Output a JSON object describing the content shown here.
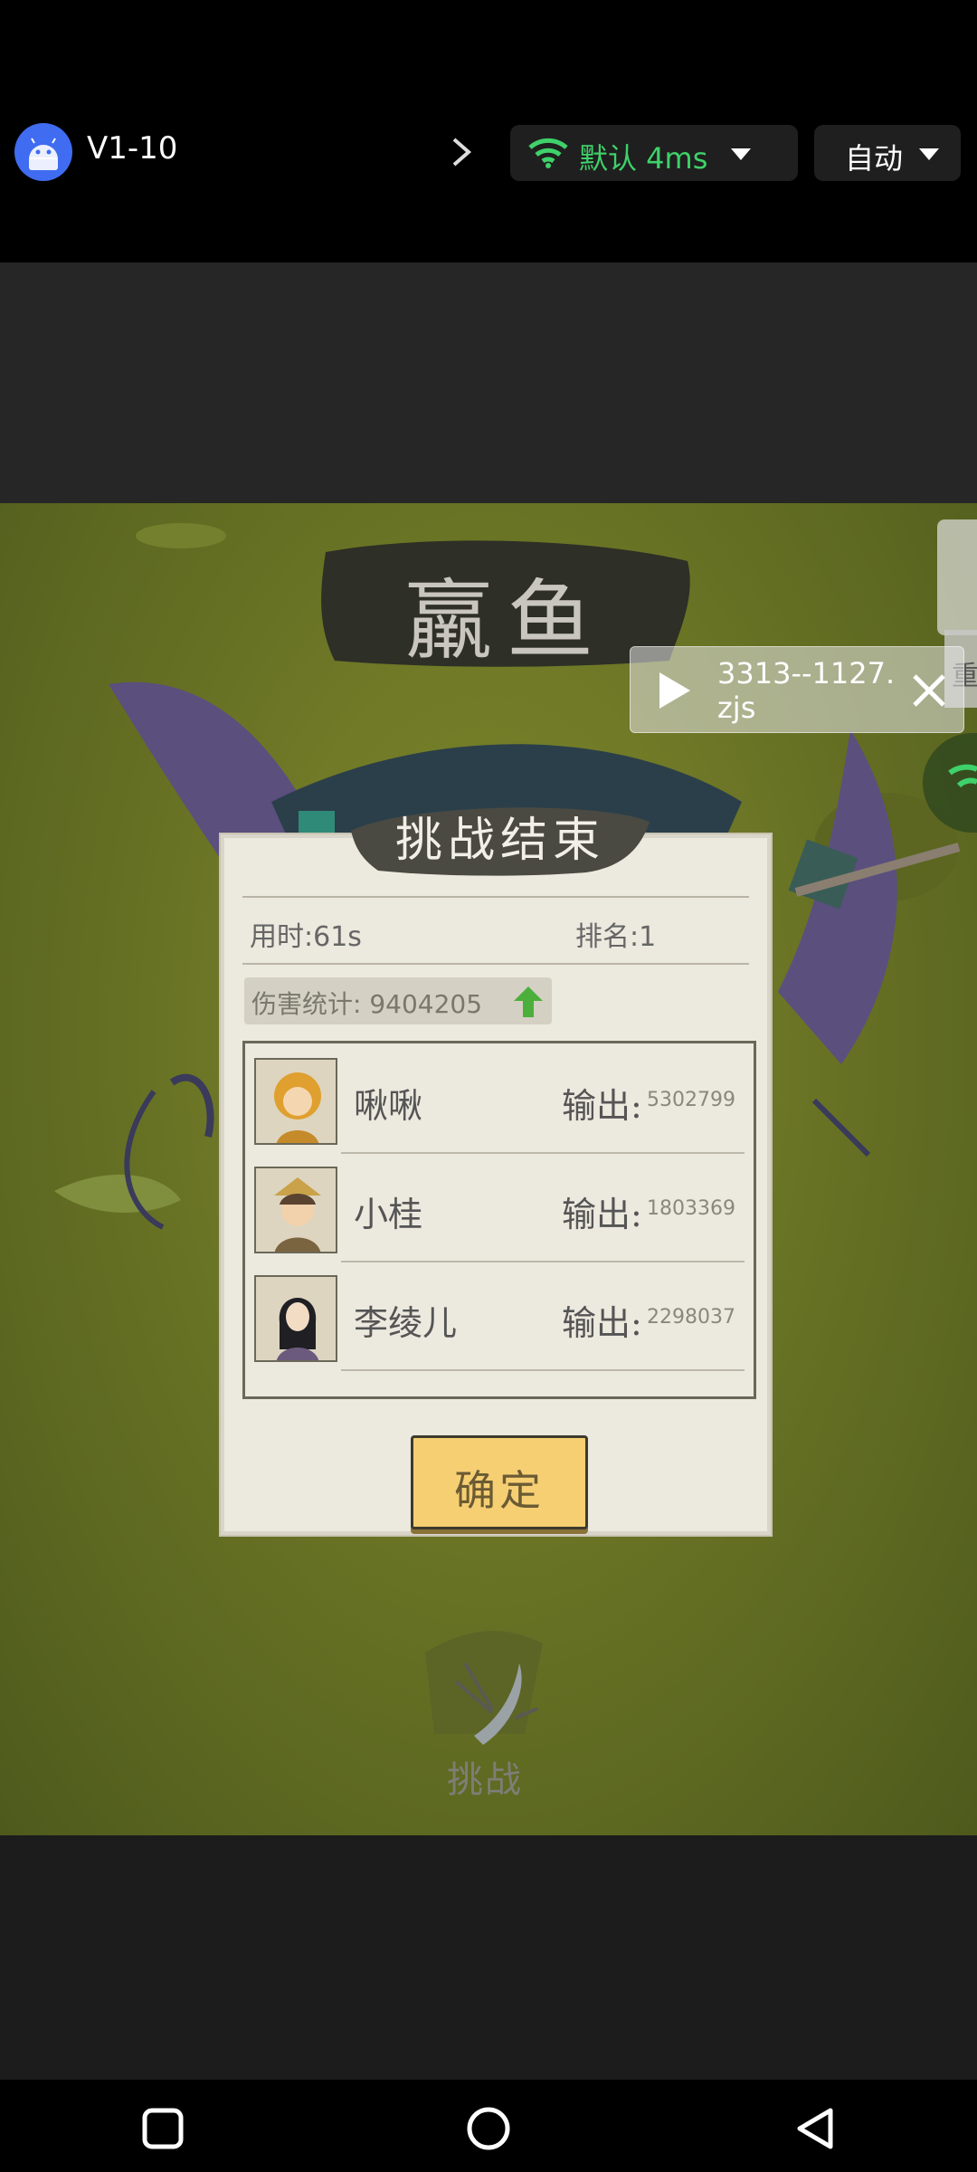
{
  "topbar": {
    "app_title": "V1-10",
    "network": {
      "label": "默认 4ms",
      "color": "#3fd16a"
    },
    "mode": {
      "label": "自动"
    }
  },
  "game": {
    "banner": "羸鱼",
    "media": {
      "filename": "3313--1127.zjs"
    },
    "side_tab_text": "重",
    "dialog": {
      "title": "挑战结束",
      "time": "用时:61s",
      "rank": "排名:1",
      "damage": "伤害统计: 9404205",
      "members": [
        {
          "name": "啾啾",
          "output_label": "输出:",
          "output_value": "5302799"
        },
        {
          "name": "小桂",
          "output_label": "输出:",
          "output_value": "1803369"
        },
        {
          "name": "李绫儿",
          "output_label": "输出:",
          "output_value": "2298037"
        }
      ],
      "confirm_label": "确定"
    },
    "challenge_label": "挑战"
  },
  "icons": {
    "app": "android-app-icon",
    "network": "wifi-icon",
    "media_play": "play-icon",
    "media_close": "close-icon",
    "damage_up": "arrow-up-icon",
    "nav": [
      "square-recents-icon",
      "circle-home-icon",
      "triangle-back-icon"
    ]
  },
  "colors": {
    "accent_green": "#3fd16a",
    "confirm_button": "#f7cf73",
    "dialog_bg": "#ece9df"
  }
}
